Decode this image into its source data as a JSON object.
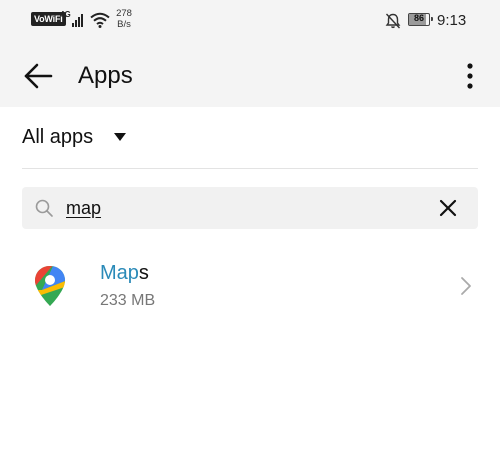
{
  "status_bar": {
    "vowifi": "VoWiFi",
    "network_type": "4G",
    "speed_value": "278",
    "speed_unit": "B/s",
    "battery_level": "86",
    "time": "9:13"
  },
  "app_bar": {
    "title": "Apps",
    "back_icon": "arrow-back-icon",
    "more_icon": "more-vertical-icon"
  },
  "filter": {
    "label": "All apps",
    "icon": "dropdown-triangle-icon"
  },
  "search": {
    "value": "map",
    "placeholder": "",
    "search_icon": "search-icon",
    "clear_icon": "close-icon"
  },
  "apps": [
    {
      "name_match": "Map",
      "name_rest": "s",
      "size": "233 MB",
      "icon": "google-maps-pin-icon"
    }
  ],
  "colors": {
    "header_bg": "#f4f4f4",
    "search_bg": "#f1f1f1",
    "highlight": "#2a8ab8",
    "secondary_text": "#777777"
  }
}
